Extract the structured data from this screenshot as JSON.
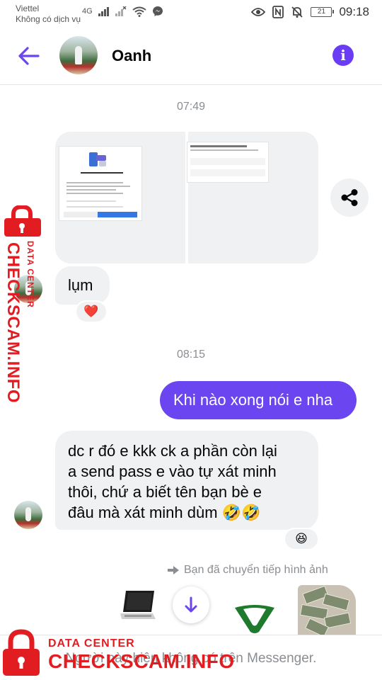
{
  "status_bar": {
    "carrier": "Viettel",
    "service": "Không có dịch vụ",
    "network": "4G",
    "battery": "21",
    "time": "09:18"
  },
  "header": {
    "contact_name": "Oanh",
    "accent_color": "#6b45ef"
  },
  "messages": [
    {
      "type": "timestamp",
      "text": "07:49"
    },
    {
      "type": "image",
      "direction": "incoming",
      "count": 2
    },
    {
      "type": "text",
      "direction": "incoming",
      "text": "lụm",
      "reaction": "❤️"
    },
    {
      "type": "timestamp",
      "text": "08:15"
    },
    {
      "type": "text",
      "direction": "outgoing",
      "text": "Khi nào xong nói e nha"
    },
    {
      "type": "text",
      "direction": "incoming",
      "lines": [
        "dc r đó e kkk ck a phần còn lại",
        "a send pass e vào tự xát minh",
        "thôi, chứ a biết tên bạn bè e",
        "đâu mà xát minh dùm 🤣🤣"
      ],
      "reaction": "😆"
    },
    {
      "type": "forward_note",
      "text": "Bạn đã chuyển tiếp hình ảnh"
    }
  ],
  "bottom_notice": "Người này hiện không có trên Messenger.",
  "watermark": {
    "line1": "DATA CENTER",
    "line2": "CHECKSCAM.INFO",
    "color": "#e11d22"
  },
  "icons": [
    "back-arrow-icon",
    "info-icon",
    "share-icon",
    "forward-icon",
    "chevron-down-icon",
    "eye-icon",
    "nfc-icon",
    "mute-icon",
    "wifi-icon",
    "messenger-icon",
    "signal-icon"
  ]
}
